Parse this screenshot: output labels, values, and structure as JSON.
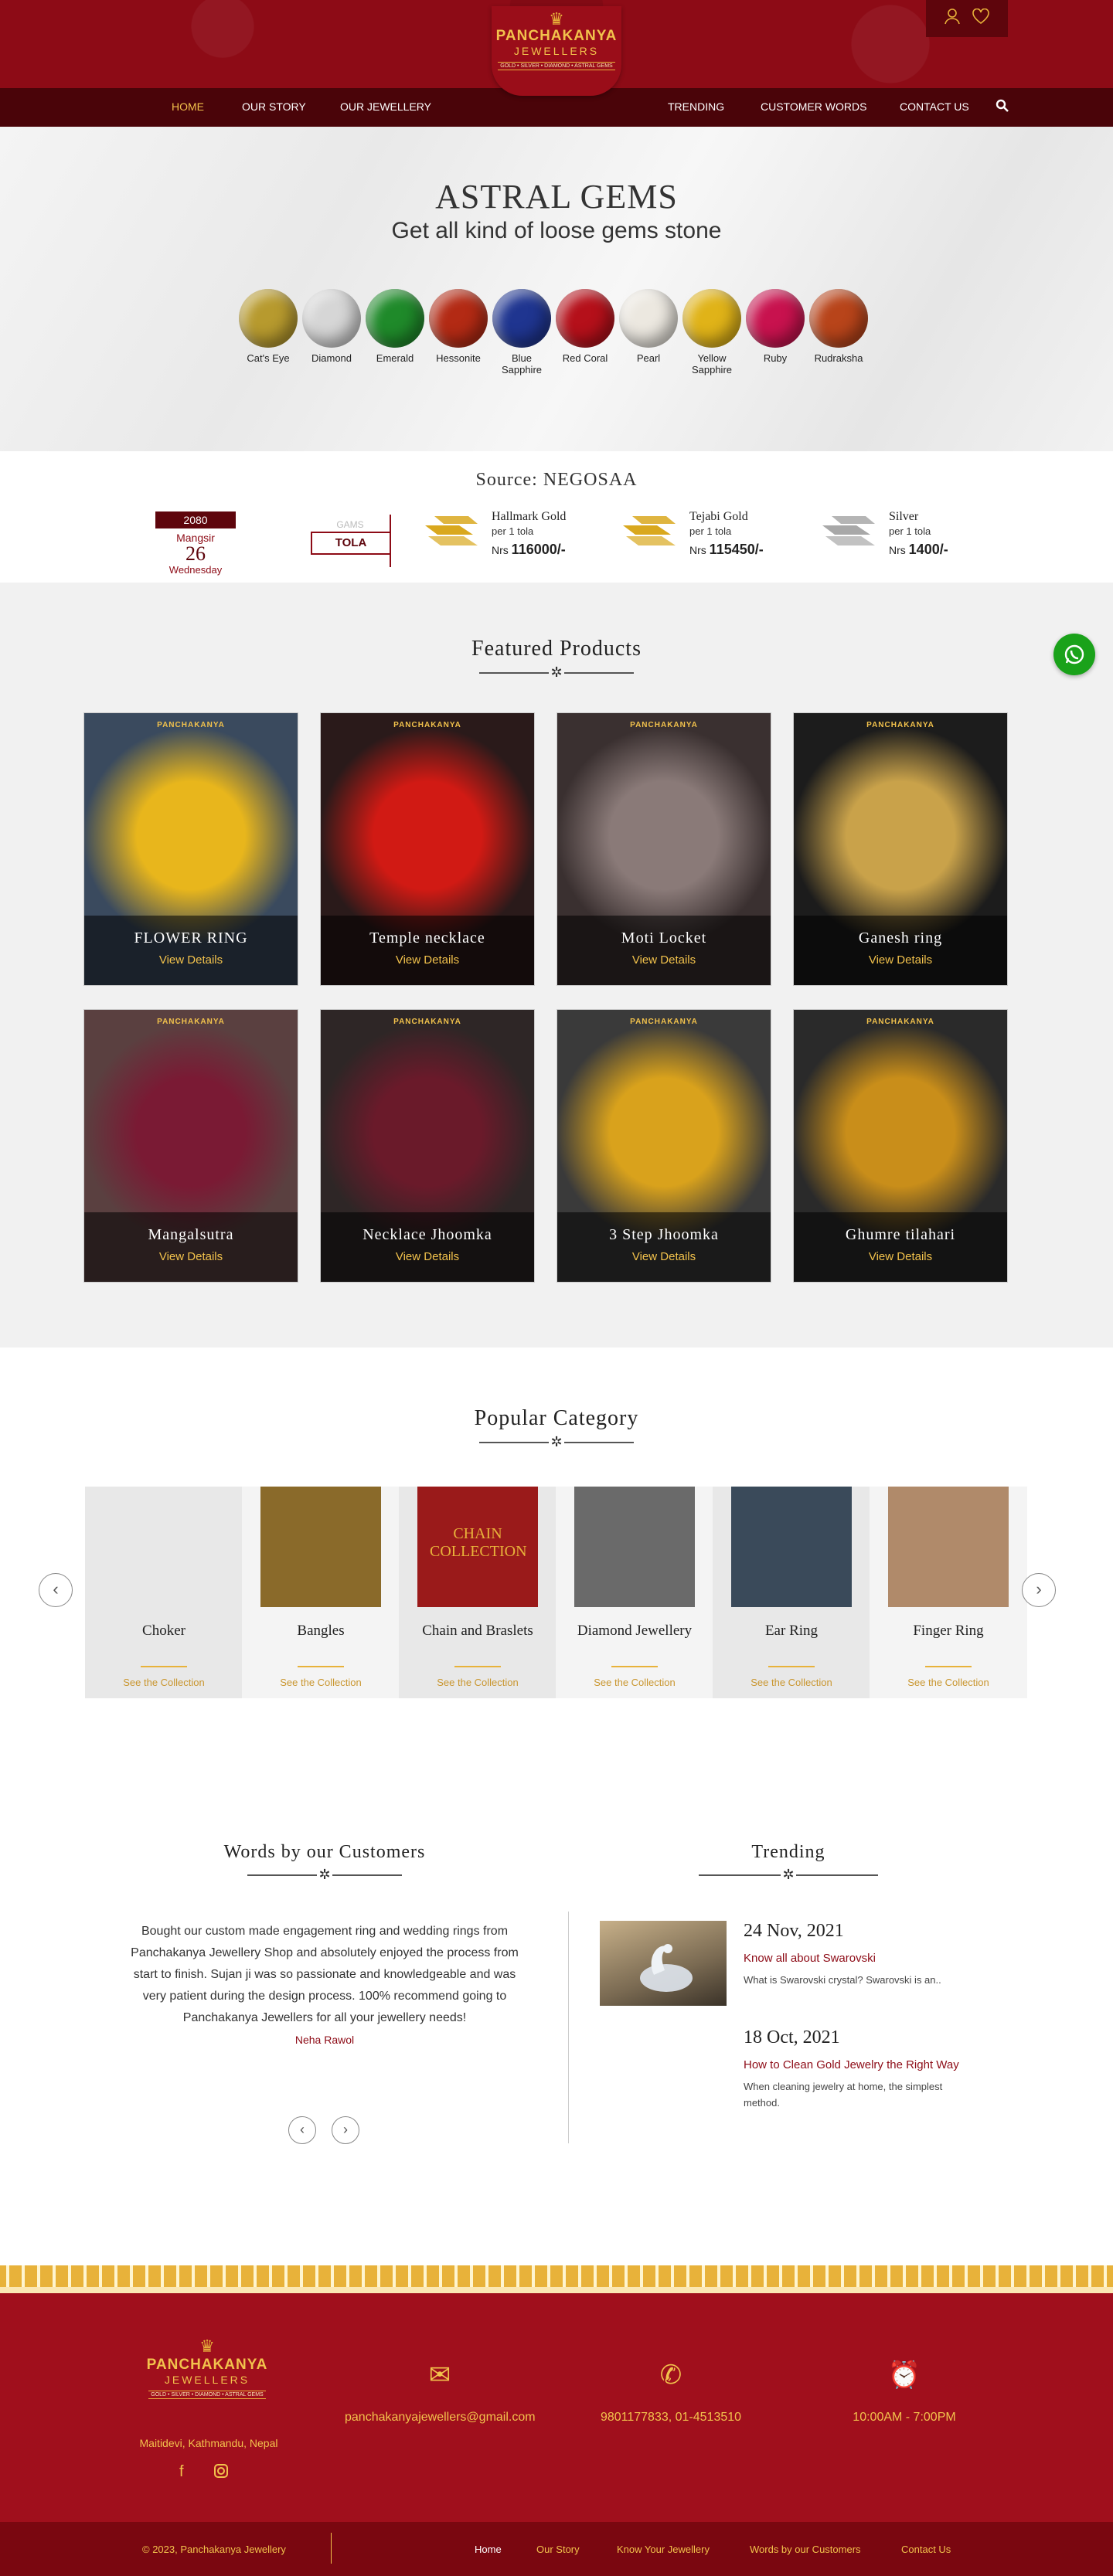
{
  "brand": {
    "name": "PANCHAKANYA",
    "sub": "JEWELLERS",
    "tagline": "GOLD • SILVER • DIAMOND • ASTRAL GEMS"
  },
  "header_icons": [
    "user-icon",
    "heart-icon"
  ],
  "nav": {
    "items": [
      "HOME",
      "OUR STORY",
      "OUR JEWELLERY",
      "TRENDING",
      "CUSTOMER WORDS",
      "CONTACT US"
    ],
    "search_icon": "search-icon"
  },
  "hero": {
    "title": "ASTRAL GEMS",
    "subtitle": "Get all kind of loose gems stone",
    "gems": [
      {
        "name": "Cat's Eye",
        "color": "#b79a2e"
      },
      {
        "name": "Diamond",
        "color": "#d6d6d6"
      },
      {
        "name": "Emerald",
        "color": "#1f8a2a"
      },
      {
        "name": "Hessonite",
        "color": "#b32a14"
      },
      {
        "name": "Blue Sapphire",
        "color": "#1f3590"
      },
      {
        "name": "Red Coral",
        "color": "#b5101a"
      },
      {
        "name": "Pearl",
        "color": "#ece8e0"
      },
      {
        "name": "Yellow Sapphire",
        "color": "#e0b318"
      },
      {
        "name": "Ruby",
        "color": "#c8124e"
      },
      {
        "name": "Rudraksha",
        "color": "#b8441a"
      }
    ]
  },
  "rates": {
    "source": "Source: NEGOSAA",
    "date": {
      "year": "2080",
      "month": "Mangsir",
      "day": "26",
      "weekday": "Wednesday"
    },
    "units": {
      "grams": "GAMS",
      "tola": "TOLA"
    },
    "items": [
      {
        "name": "Hallmark Gold",
        "per": "per 1 tola",
        "currency": "Nrs",
        "value": "116000/-",
        "color": "#d9a81e"
      },
      {
        "name": "Tejabi Gold",
        "per": "per 1 tola",
        "currency": "Nrs",
        "value": "115450/-",
        "color": "#d9a81e"
      },
      {
        "name": "Silver",
        "per": "per 1 tola",
        "currency": "Nrs",
        "value": "1400/-",
        "color": "#a8a8a8"
      }
    ]
  },
  "featured": {
    "title": "Featured Products",
    "view_label": "View Details",
    "products": [
      {
        "name": "FLOWER RING",
        "bg": "#3a4a5e",
        "accent": "#e8b61c"
      },
      {
        "name": "Temple necklace",
        "bg": "#2a1a1a",
        "accent": "#d11a14"
      },
      {
        "name": "Moti Locket",
        "bg": "#3a3030",
        "accent": "#8a7a78"
      },
      {
        "name": "Ganesh ring",
        "bg": "#1c1c1c",
        "accent": "#c9a24a"
      },
      {
        "name": "Mangalsutra",
        "bg": "#5a4040",
        "accent": "#7a1a34"
      },
      {
        "name": "Necklace Jhoomka",
        "bg": "#2e2626",
        "accent": "#6a1a2a"
      },
      {
        "name": "3 Step Jhoomka",
        "bg": "#3a3a3a",
        "accent": "#d9a21c"
      },
      {
        "name": "Ghumre tilahari",
        "bg": "#2a2a2a",
        "accent": "#c98e1a"
      }
    ]
  },
  "whatsapp_icon": "whatsapp-icon",
  "category": {
    "title": "Popular Category",
    "see_label": "See the Collection",
    "items": [
      {
        "name": "Choker",
        "bg": "#e8e8e8",
        "img": "#e8e8e8"
      },
      {
        "name": "Bangles",
        "bg": "#f4f4f4",
        "img": "#8a6a2a"
      },
      {
        "name": "Chain and Braslets",
        "bg": "#e8e8e8",
        "img": "#9a1a1a",
        "img_text": "CHAIN COLLECTION"
      },
      {
        "name": "Diamond Jewellery",
        "bg": "#f4f4f4",
        "img": "#6a6a6a"
      },
      {
        "name": "Ear Ring",
        "bg": "#e8e8e8",
        "img": "#3a4a5a"
      },
      {
        "name": "Finger Ring",
        "bg": "#f4f4f4",
        "img": "#b08a6a"
      }
    ]
  },
  "testimonials": {
    "title": "Words by our Customers",
    "quote": "Bought our custom made engagement ring and wedding rings from Panchakanya Jewellery Shop and absolutely enjoyed the process from start to finish. Sujan ji was so passionate and knowledgeable and was very patient during the design process. 100% recommend going to Panchakanya Jewellers for all your jewellery needs!",
    "author": "Neha Rawol"
  },
  "trending": {
    "title": "Trending",
    "posts": [
      {
        "date": "24 Nov, 2021",
        "title": "Know all about Swarovski",
        "excerpt": "What is Swarovski crystal? Swarovski is an.."
      },
      {
        "date": "18 Oct, 2021",
        "title": "How to Clean Gold Jewelry the Right Way",
        "excerpt": "When cleaning jewelry at home, the simplest method."
      }
    ]
  },
  "footer": {
    "address": "Maitidevi, Kathmandu, Nepal",
    "email": "panchakanyajewellers@gmail.com",
    "phone": "9801177833, 01-4513510",
    "hours": "10:00AM - 7:00PM",
    "copyright": "© 2023, Panchakanya Jewellery",
    "links": [
      "Home",
      "Our Story",
      "Know Your Jewellery",
      "Words by our Customers",
      "Contact Us"
    ]
  }
}
